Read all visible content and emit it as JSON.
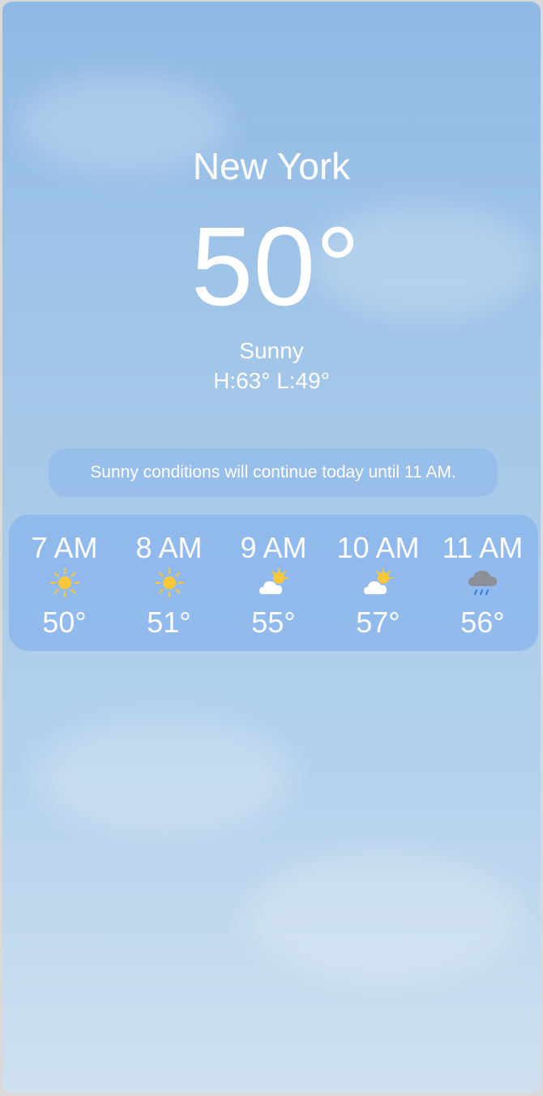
{
  "location": {
    "city": "New York"
  },
  "current": {
    "temperature": "50°",
    "condition": "Sunny",
    "high_low": "H:63° L:49°"
  },
  "summary": "Sunny conditions will continue today until 11 AM.",
  "hourly": [
    {
      "time": "7 AM",
      "icon": "sun-icon",
      "temp": "50°"
    },
    {
      "time": "8 AM",
      "icon": "sun-icon",
      "temp": "51°"
    },
    {
      "time": "9 AM",
      "icon": "partly-cloudy-icon",
      "temp": "55°"
    },
    {
      "time": "10 AM",
      "icon": "partly-cloudy-icon",
      "temp": "57°"
    },
    {
      "time": "11 AM",
      "icon": "rain-cloud-icon",
      "temp": "56°"
    }
  ],
  "colors": {
    "sun": "#f6c83a",
    "rain_cloud": "#8a8f98",
    "rain_drops": "#2f7de1"
  }
}
